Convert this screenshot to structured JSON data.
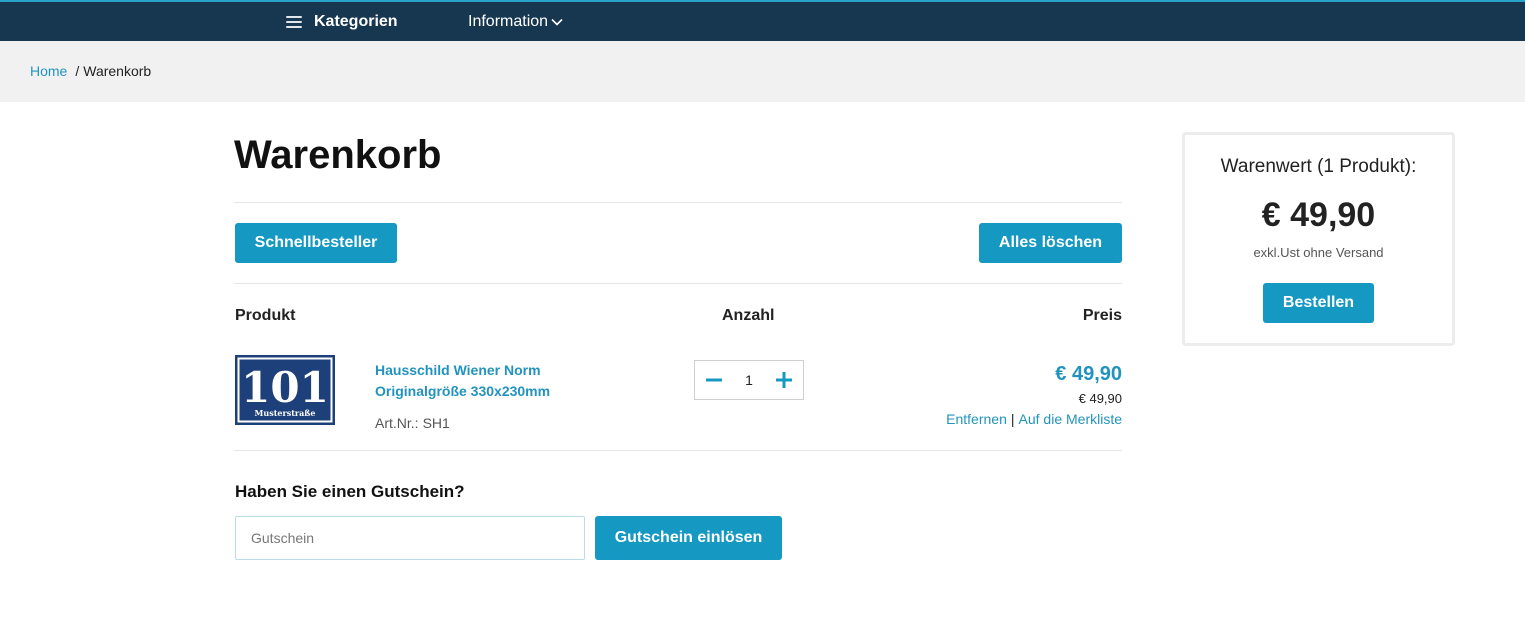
{
  "nav": {
    "categories_label": "Kategorien",
    "information_label": "Information"
  },
  "breadcrumb": {
    "home": "Home",
    "separator": "/",
    "current": "Warenkorb"
  },
  "page": {
    "title": "Warenkorb"
  },
  "actions": {
    "quick_order": "Schnellbesteller",
    "clear_all": "Alles löschen"
  },
  "table": {
    "headers": {
      "product": "Produkt",
      "quantity": "Anzahl",
      "price": "Preis"
    }
  },
  "items": [
    {
      "image_text": "101",
      "image_subtext": "Musterstraße",
      "name": "Hausschild Wiener Norm Originalgröße 330x230mm",
      "art_label": "Art.Nr.:",
      "art_no": "SH1",
      "quantity": "1",
      "price": "€ 49,90",
      "unit_price": "€ 49,90",
      "remove_label": "Entfernen",
      "link_separator": "|",
      "wishlist_label": "Auf die Merkliste"
    }
  ],
  "coupon": {
    "heading": "Haben Sie einen Gutschein?",
    "placeholder": "Gutschein",
    "value": "",
    "button": "Gutschein einlösen"
  },
  "summary": {
    "label": "Warenwert (1 Produkt):",
    "value": "€ 49,90",
    "note": "exkl.Ust ohne Versand",
    "order_button": "Bestellen"
  },
  "colors": {
    "nav_bg": "#173751",
    "accent": "#1598c2",
    "link": "#2293be",
    "sign_blue": "#1d3f7a"
  }
}
